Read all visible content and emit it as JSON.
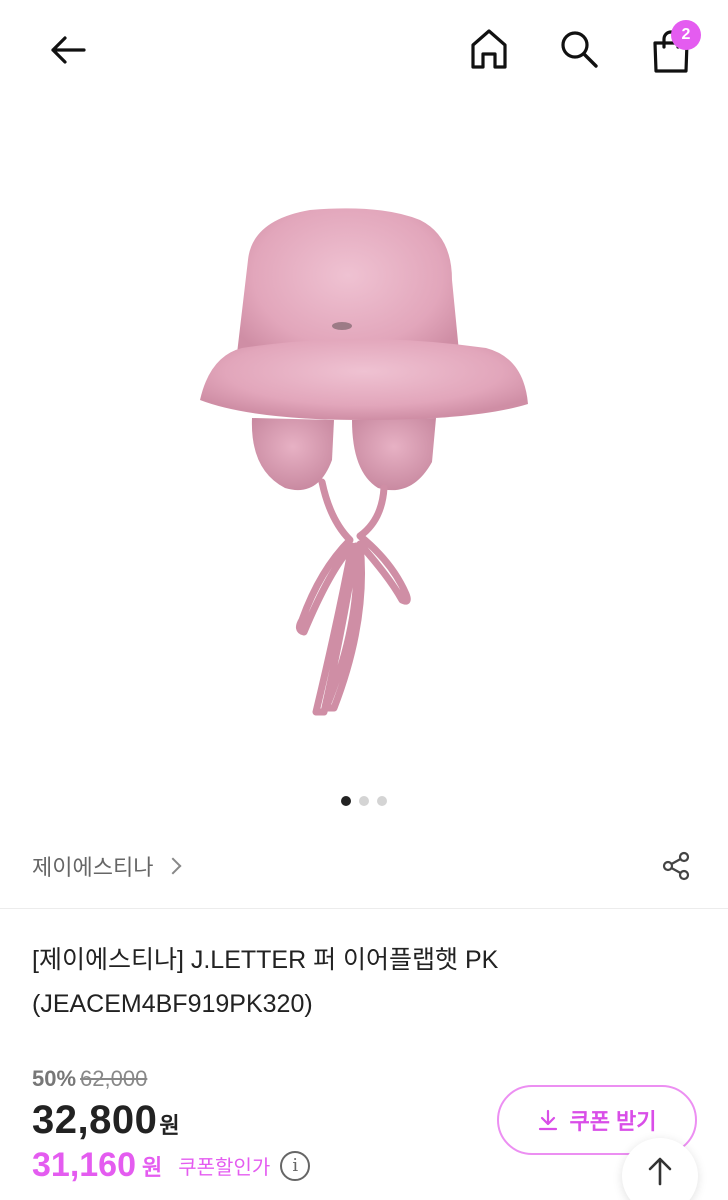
{
  "header": {
    "back_icon": "arrow-left-icon",
    "home_icon": "home-icon",
    "search_icon": "search-icon",
    "cart_icon": "shopping-bag-icon",
    "cart_count": "2",
    "badge_color": "#e45cf0"
  },
  "gallery": {
    "image_subject": "pink fleece bucket hat with ear flaps and ribbon ties",
    "total_slides": 3,
    "active_slide": 1
  },
  "brand": {
    "name": "제이에스티나",
    "share_icon": "share-icon"
  },
  "product": {
    "name_line1": "[제이에스티나] J.LETTER 퍼 이어플랩햇 PK",
    "name_line2": "(JEACEM4BF919PK320)"
  },
  "pricing": {
    "discount_rate": "50%",
    "original_price": "62,000",
    "sale_price": "32,800",
    "currency_unit": "원",
    "coupon_price": "31,160",
    "coupon_label": "쿠폰할인가",
    "accent_color": "#e45cf0"
  },
  "coupon_button": {
    "label": "쿠폰 받기",
    "icon": "download-icon"
  },
  "scroll_top": {
    "icon": "arrow-up-icon"
  }
}
